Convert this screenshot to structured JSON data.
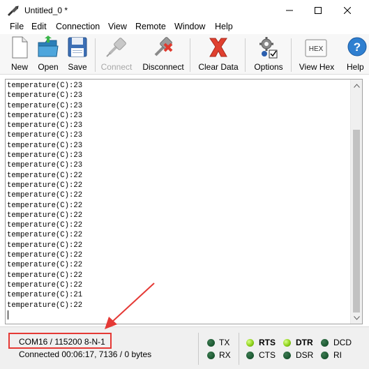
{
  "window": {
    "title": "Untitled_0 *"
  },
  "menu": {
    "items": [
      "File",
      "Edit",
      "Connection",
      "View",
      "Remote",
      "Window",
      "Help"
    ]
  },
  "toolbar": {
    "new_label": "New",
    "open_label": "Open",
    "save_label": "Save",
    "connect_label": "Connect",
    "disconnect_label": "Disconnect",
    "clear_label": "Clear Data",
    "options_label": "Options",
    "viewhex_label": "View Hex",
    "help_label": "Help",
    "hex_icon_text": "HEX"
  },
  "terminal": {
    "lines": [
      "temperature(C):23",
      "temperature(C):23",
      "temperature(C):23",
      "temperature(C):23",
      "temperature(C):23",
      "temperature(C):23",
      "temperature(C):23",
      "temperature(C):23",
      "temperature(C):23",
      "temperature(C):22",
      "temperature(C):22",
      "temperature(C):22",
      "temperature(C):22",
      "temperature(C):22",
      "temperature(C):22",
      "temperature(C):22",
      "temperature(C):22",
      "temperature(C):22",
      "temperature(C):22",
      "temperature(C):22",
      "temperature(C):22",
      "temperature(C):21",
      "temperature(C):22"
    ]
  },
  "status": {
    "port_settings": "COM16 / 115200 8-N-1",
    "connection_info": "Connected 00:06:17, 7136 / 0 bytes",
    "signals": {
      "tx": "TX",
      "rx": "RX",
      "rts": "RTS",
      "cts": "CTS",
      "dtr": "DTR",
      "dsr": "DSR",
      "dcd": "DCD",
      "ri": "RI"
    }
  },
  "colors": {
    "highlight": "#e53935",
    "led_on": "#8fd21a",
    "led_off": "#1d5b33"
  }
}
